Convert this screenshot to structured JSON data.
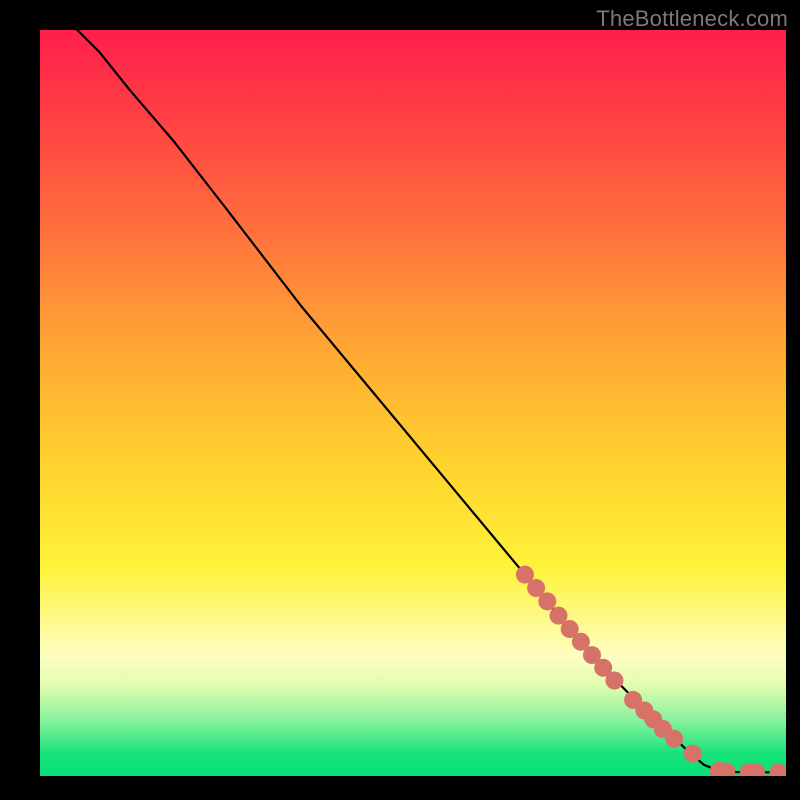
{
  "watermark": "TheBottleneck.com",
  "chart_data": {
    "type": "line",
    "title": "",
    "xlabel": "",
    "ylabel": "",
    "xlim": [
      0,
      100
    ],
    "ylim": [
      0,
      100
    ],
    "grid": false,
    "curve": {
      "name": "",
      "color": "#000000",
      "points": [
        {
          "x": 5,
          "y": 100
        },
        {
          "x": 8,
          "y": 97
        },
        {
          "x": 12,
          "y": 92
        },
        {
          "x": 18,
          "y": 85
        },
        {
          "x": 25,
          "y": 76
        },
        {
          "x": 35,
          "y": 63
        },
        {
          "x": 45,
          "y": 51
        },
        {
          "x": 55,
          "y": 39
        },
        {
          "x": 65,
          "y": 27
        },
        {
          "x": 72,
          "y": 18.5
        },
        {
          "x": 78,
          "y": 12
        },
        {
          "x": 83,
          "y": 7
        },
        {
          "x": 87,
          "y": 3.2
        },
        {
          "x": 89,
          "y": 1.5
        },
        {
          "x": 91,
          "y": 0.7
        },
        {
          "x": 94,
          "y": 0.5
        },
        {
          "x": 97,
          "y": 0.5
        },
        {
          "x": 99,
          "y": 0.5
        }
      ]
    },
    "markers": {
      "name": "",
      "color": "#d77268",
      "points": [
        {
          "x": 65,
          "y": 27
        },
        {
          "x": 66.5,
          "y": 25.2
        },
        {
          "x": 68,
          "y": 23.4
        },
        {
          "x": 69.5,
          "y": 21.5
        },
        {
          "x": 71,
          "y": 19.7
        },
        {
          "x": 72.5,
          "y": 18
        },
        {
          "x": 74,
          "y": 16.2
        },
        {
          "x": 75.5,
          "y": 14.5
        },
        {
          "x": 77,
          "y": 12.8
        },
        {
          "x": 79.5,
          "y": 10.2
        },
        {
          "x": 81,
          "y": 8.8
        },
        {
          "x": 82.2,
          "y": 7.6
        },
        {
          "x": 83.5,
          "y": 6.3
        },
        {
          "x": 85,
          "y": 5
        },
        {
          "x": 87.5,
          "y": 3
        },
        {
          "x": 91,
          "y": 0.7
        },
        {
          "x": 92,
          "y": 0.6
        },
        {
          "x": 95,
          "y": 0.5
        },
        {
          "x": 96,
          "y": 0.5
        },
        {
          "x": 99,
          "y": 0.5
        }
      ]
    }
  }
}
